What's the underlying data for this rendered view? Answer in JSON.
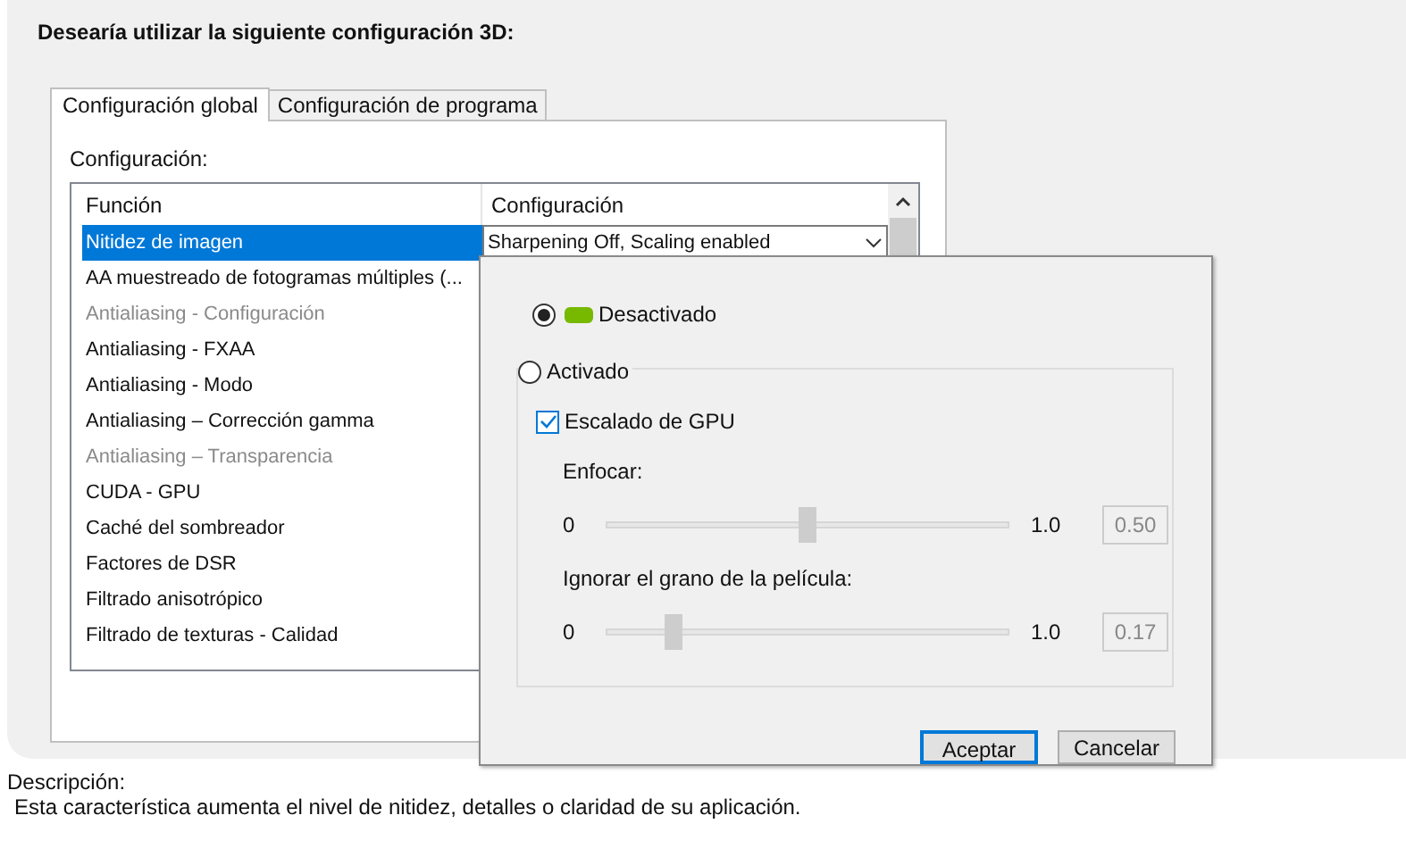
{
  "heading": "Desearía utilizar la siguiente configuración 3D:",
  "tabs": [
    {
      "label": "Configuración global",
      "selected": true
    },
    {
      "label": "Configuración de programa",
      "selected": false
    }
  ],
  "settings_label": "Configuración:",
  "table": {
    "columns": [
      "Función",
      "Configuración"
    ],
    "rows": [
      {
        "name": "Nitidez de imagen",
        "value": "Sharpening Off, Scaling enabled",
        "selected": true,
        "disabled": false
      },
      {
        "name": "AA muestreado de fotogramas múltiples (...",
        "selected": false,
        "disabled": false
      },
      {
        "name": "Antialiasing - Configuración",
        "selected": false,
        "disabled": true
      },
      {
        "name": "Antialiasing - FXAA",
        "selected": false,
        "disabled": false
      },
      {
        "name": "Antialiasing - Modo",
        "selected": false,
        "disabled": false
      },
      {
        "name": "Antialiasing – Corrección gamma",
        "selected": false,
        "disabled": false
      },
      {
        "name": "Antialiasing – Transparencia",
        "selected": false,
        "disabled": true
      },
      {
        "name": "CUDA - GPU",
        "selected": false,
        "disabled": false
      },
      {
        "name": "Caché del sombreador",
        "selected": false,
        "disabled": false
      },
      {
        "name": "Factores de DSR",
        "selected": false,
        "disabled": false
      },
      {
        "name": "Filtrado anisotrópico",
        "selected": false,
        "disabled": false
      },
      {
        "name": "Filtrado de texturas - Calidad",
        "selected": false,
        "disabled": false
      }
    ]
  },
  "popup": {
    "options": [
      {
        "label": "Desactivado",
        "selected": true
      },
      {
        "label": "Activado",
        "selected": false
      }
    ],
    "checkbox": {
      "label": "Escalado de GPU",
      "checked": true
    },
    "sliders": [
      {
        "label": "Enfocar:",
        "min": "0",
        "max": "1.0",
        "level": 0.5,
        "reading": "0.50"
      },
      {
        "label": "Ignorar el grano de la película:",
        "min": "0",
        "max": "1.0",
        "level": 0.17,
        "reading": "0.17"
      }
    ],
    "buttons": [
      {
        "label": "Aceptar",
        "default": true
      },
      {
        "label": "Cancelar",
        "default": false
      }
    ]
  },
  "description": {
    "label": "Descripción:",
    "text": "Esta característica aumenta el nivel de nitidez, detalles o claridad de su aplicación."
  }
}
